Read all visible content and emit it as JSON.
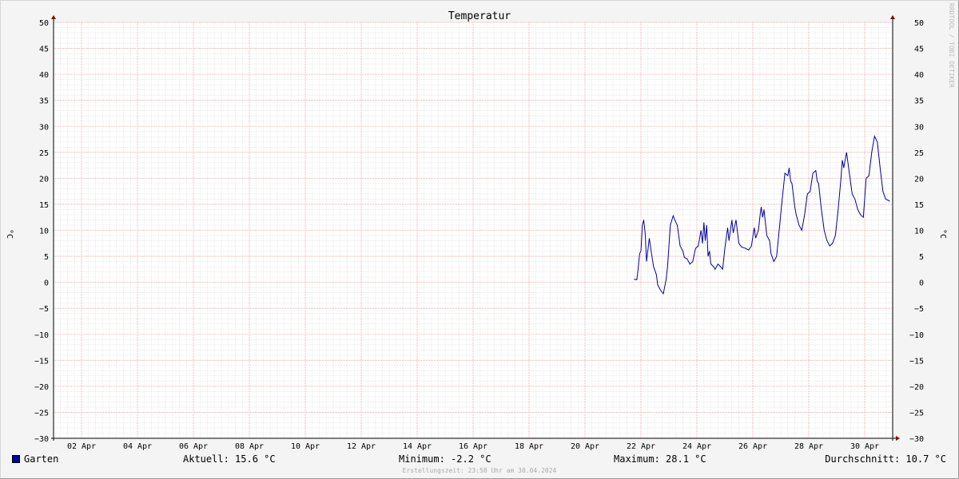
{
  "chart_data": {
    "type": "line",
    "title": "Temperatur",
    "ylabel": "°C",
    "xlabel": "",
    "ylim": [
      -30,
      50
    ],
    "yticks": [
      -30,
      -25,
      -20,
      -15,
      -10,
      -5,
      0,
      5,
      10,
      15,
      20,
      25,
      30,
      35,
      40,
      45,
      50
    ],
    "xlim": [
      "2024-04-01 00:00",
      "2024-05-01 00:00"
    ],
    "xtick_labels": [
      "02 Apr",
      "04 Apr",
      "06 Apr",
      "08 Apr",
      "10 Apr",
      "12 Apr",
      "14 Apr",
      "16 Apr",
      "18 Apr",
      "20 Apr",
      "22 Apr",
      "24 Apr",
      "26 Apr",
      "28 Apr",
      "30 Apr"
    ],
    "grid": true,
    "series": [
      {
        "name": "Garten",
        "color": "#0000a0",
        "x_unit": "day of April",
        "points": [
          [
            21.75,
            0.6
          ],
          [
            21.85,
            0.5
          ],
          [
            21.9,
            2.5
          ],
          [
            21.95,
            5.5
          ],
          [
            22.0,
            6.0
          ],
          [
            22.05,
            11.0
          ],
          [
            22.1,
            12.0
          ],
          [
            22.15,
            9.5
          ],
          [
            22.2,
            4.0
          ],
          [
            22.3,
            8.5
          ],
          [
            22.35,
            6.5
          ],
          [
            22.45,
            3.0
          ],
          [
            22.55,
            1.5
          ],
          [
            22.6,
            -0.5
          ],
          [
            22.7,
            -1.5
          ],
          [
            22.8,
            -2.2
          ],
          [
            22.9,
            0.5
          ],
          [
            22.95,
            3.0
          ],
          [
            23.05,
            11.0
          ],
          [
            23.15,
            12.8
          ],
          [
            23.25,
            11.5
          ],
          [
            23.3,
            11.0
          ],
          [
            23.4,
            7.0
          ],
          [
            23.5,
            6.0
          ],
          [
            23.55,
            4.8
          ],
          [
            23.65,
            4.5
          ],
          [
            23.75,
            3.5
          ],
          [
            23.85,
            4.0
          ],
          [
            23.95,
            6.5
          ],
          [
            24.05,
            7.0
          ],
          [
            24.1,
            8.5
          ],
          [
            24.15,
            10.0
          ],
          [
            24.2,
            7.5
          ],
          [
            24.25,
            11.5
          ],
          [
            24.3,
            8.0
          ],
          [
            24.35,
            11.0
          ],
          [
            24.4,
            5.0
          ],
          [
            24.45,
            6.0
          ],
          [
            24.5,
            3.5
          ],
          [
            24.6,
            3.0
          ],
          [
            24.65,
            2.5
          ],
          [
            24.75,
            3.5
          ],
          [
            24.85,
            3.0
          ],
          [
            24.92,
            2.5
          ],
          [
            25.0,
            6.5
          ],
          [
            25.1,
            10.5
          ],
          [
            25.15,
            8.0
          ],
          [
            25.25,
            12.0
          ],
          [
            25.3,
            9.5
          ],
          [
            25.4,
            12.0
          ],
          [
            25.5,
            7.5
          ],
          [
            25.6,
            6.8
          ],
          [
            25.75,
            6.5
          ],
          [
            25.85,
            6.2
          ],
          [
            25.95,
            7.0
          ],
          [
            26.05,
            10.5
          ],
          [
            26.1,
            8.5
          ],
          [
            26.2,
            10.0
          ],
          [
            26.25,
            12.5
          ],
          [
            26.3,
            14.5
          ],
          [
            26.35,
            12.5
          ],
          [
            26.4,
            14.0
          ],
          [
            26.5,
            9.0
          ],
          [
            26.6,
            8.0
          ],
          [
            26.65,
            5.5
          ],
          [
            26.75,
            4.0
          ],
          [
            26.85,
            5.0
          ],
          [
            26.95,
            10.5
          ],
          [
            27.05,
            16.0
          ],
          [
            27.15,
            21.0
          ],
          [
            27.25,
            20.5
          ],
          [
            27.3,
            22.0
          ],
          [
            27.35,
            19.5
          ],
          [
            27.4,
            19.0
          ],
          [
            27.5,
            14.5
          ],
          [
            27.55,
            13.0
          ],
          [
            27.65,
            11.0
          ],
          [
            27.75,
            10.0
          ],
          [
            27.85,
            13.0
          ],
          [
            27.95,
            17.0
          ],
          [
            28.05,
            17.5
          ],
          [
            28.15,
            21.0
          ],
          [
            28.25,
            21.5
          ],
          [
            28.3,
            19.5
          ],
          [
            28.35,
            19.0
          ],
          [
            28.45,
            14.0
          ],
          [
            28.55,
            10.0
          ],
          [
            28.65,
            8.0
          ],
          [
            28.75,
            7.0
          ],
          [
            28.85,
            7.5
          ],
          [
            28.95,
            9.0
          ],
          [
            29.05,
            14.0
          ],
          [
            29.15,
            20.0
          ],
          [
            29.2,
            23.5
          ],
          [
            29.25,
            22.0
          ],
          [
            29.35,
            25.0
          ],
          [
            29.45,
            21.0
          ],
          [
            29.55,
            17.0
          ],
          [
            29.65,
            16.0
          ],
          [
            29.75,
            14.0
          ],
          [
            29.85,
            13.0
          ],
          [
            29.95,
            12.5
          ],
          [
            30.05,
            20.0
          ],
          [
            30.15,
            20.5
          ],
          [
            30.25,
            25.0
          ],
          [
            30.35,
            28.1
          ],
          [
            30.45,
            27.0
          ],
          [
            30.55,
            22.0
          ],
          [
            30.65,
            17.5
          ],
          [
            30.75,
            16.0
          ],
          [
            30.9,
            15.6
          ]
        ]
      }
    ]
  },
  "legend": {
    "series_name": "Garten",
    "aktuell": "Aktuell: 15.6 °C",
    "minimum": "Minimum: -2.2 °C",
    "maximum": "Maximum: 28.1 °C",
    "durchschnitt": "Durchschnitt: 10.7 °C"
  },
  "footer": "Erstellungszeit: 23:58 Uhr am 30.04.2024",
  "watermark": "RRDTOOL / TOBI OETIKER"
}
